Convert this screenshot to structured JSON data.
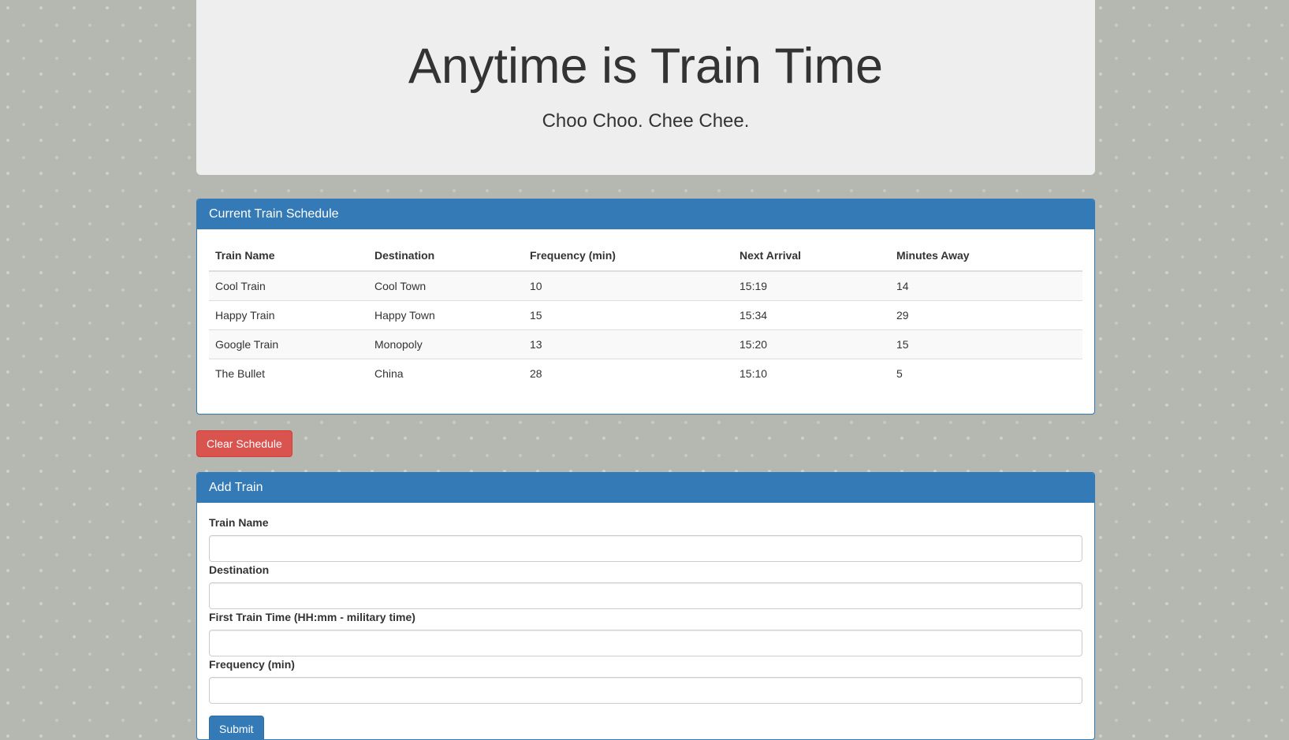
{
  "jumbotron": {
    "title": "Anytime is Train Time",
    "subtitle": "Choo Choo. Chee Chee."
  },
  "schedule": {
    "heading": "Current Train Schedule",
    "columns": [
      "Train Name",
      "Destination",
      "Frequency (min)",
      "Next Arrival",
      "Minutes Away"
    ],
    "rows": [
      [
        "Cool Train",
        "Cool Town",
        "10",
        "15:19",
        "14"
      ],
      [
        "Happy Train",
        "Happy Town",
        "15",
        "15:34",
        "29"
      ],
      [
        "Google Train",
        "Monopoly",
        "13",
        "15:20",
        "15"
      ],
      [
        "The Bullet",
        "China",
        "28",
        "15:10",
        "5"
      ]
    ]
  },
  "clear_button": "Clear Schedule",
  "add_train": {
    "heading": "Add Train",
    "fields": [
      {
        "label": "Train Name",
        "value": ""
      },
      {
        "label": "Destination",
        "value": ""
      },
      {
        "label": "First Train Time (HH:mm - military time)",
        "value": ""
      },
      {
        "label": "Frequency (min)",
        "value": ""
      }
    ],
    "submit": "Submit"
  },
  "colors": {
    "primary": "#337ab7",
    "danger": "#d9534f",
    "background": "#b4b8b1"
  }
}
